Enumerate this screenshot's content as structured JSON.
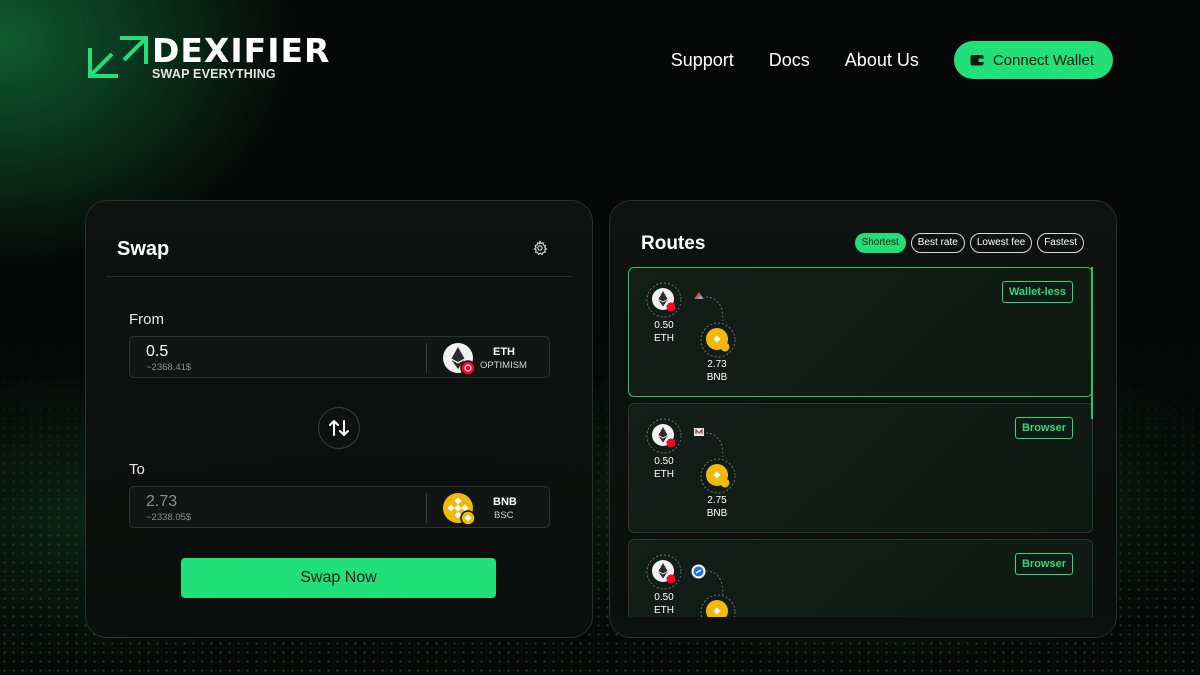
{
  "brand": {
    "name": "DEXIFIER",
    "tagline": "SWAP EVERYTHING",
    "accent_color": "#21e07a"
  },
  "nav": {
    "items": [
      "Support",
      "Docs",
      "About Us"
    ],
    "connect_wallet": "Connect Wallet",
    "connect_wallet_icon": "wallet-icon"
  },
  "swap": {
    "title": "Swap",
    "settings_icon": "gear-icon",
    "from": {
      "label": "From",
      "amount": "0.5",
      "usd": "~2368.41$",
      "token": "ETH",
      "chain": "OPTIMISM",
      "icon": "eth-icon"
    },
    "flip_icon": "swap-arrows-icon",
    "to": {
      "label": "To",
      "amount": "2.73",
      "usd": "~2338.05$",
      "token": "BNB",
      "chain": "BSC",
      "icon": "bnb-icon"
    },
    "submit": "Swap Now"
  },
  "routes": {
    "title": "Routes",
    "filters": [
      {
        "label": "Shortest",
        "active": true
      },
      {
        "label": "Best rate",
        "active": false
      },
      {
        "label": "Lowest fee",
        "active": false
      },
      {
        "label": "Fastest",
        "active": false
      }
    ],
    "items": [
      {
        "badge": "Wallet-less",
        "from_amount": "0.50",
        "from_token": "ETH",
        "to_amount": "2.73",
        "to_token": "BNB",
        "provider_icon": "wing-provider-icon",
        "selected": true
      },
      {
        "badge": "Browser",
        "from_amount": "0.50",
        "from_token": "ETH",
        "to_amount": "2.75",
        "to_token": "BNB",
        "provider_icon": "m-provider-icon",
        "selected": false
      },
      {
        "badge": "Browser",
        "from_amount": "0.50",
        "from_token": "ETH",
        "to_amount": "",
        "to_token": "",
        "provider_icon": "blue-circle-provider-icon",
        "selected": false
      }
    ]
  }
}
